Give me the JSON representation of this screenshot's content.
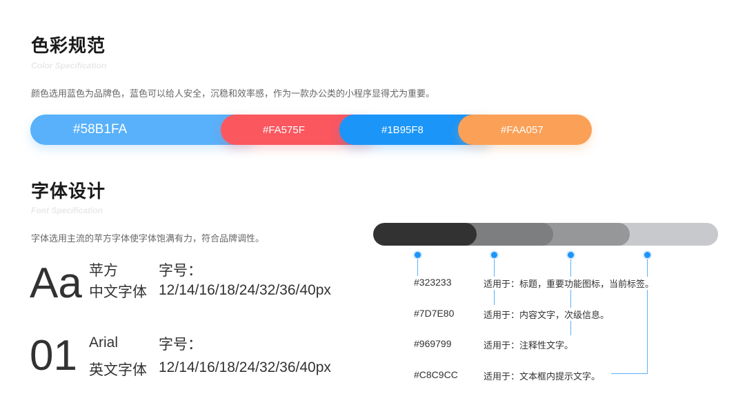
{
  "color_section": {
    "title": "色彩规范",
    "subtitle": "Color Specification",
    "description": "颜色选用蓝色为品牌色，蓝色可以给人安全，沉稳和效率感，作为一款办公类的小程序显得尤为重要。",
    "swatches": [
      {
        "label": "#58B1FA",
        "color": "#58B1FA"
      },
      {
        "label": "#FA575F",
        "color": "#FA575F"
      },
      {
        "label": "#1B95F8",
        "color": "#1B95F8"
      },
      {
        "label": "#FAA057",
        "color": "#FAA057"
      }
    ]
  },
  "font_section": {
    "title": "字体设计",
    "subtitle": "Font Specification",
    "description": "字体选用主流的苹方字体使字体饱满有力，符合品牌调性。",
    "chinese": {
      "sample": "Aa",
      "font_name": "苹方",
      "font_label": "中文字体",
      "size_label": "字号：",
      "sizes": "12/14/16/18/24/32/36/40px"
    },
    "english": {
      "sample": "01",
      "font_name": "Arial",
      "font_label": "英文字体",
      "size_label": "字号：",
      "sizes": "12/14/16/18/24/32/36/40px"
    }
  },
  "text_colors": [
    {
      "hex": "#323233",
      "usage": "适用于：标题，重要功能图标，当前标签。",
      "color": "#323233"
    },
    {
      "hex": "#7D7E80",
      "usage": "适用于：内容文字，次级信息。",
      "color": "#7D7E80"
    },
    {
      "hex": "#969799",
      "usage": "适用于：注释性文字。",
      "color": "#969799"
    },
    {
      "hex": "#C8C9CC",
      "usage": "适用于：文本框内提示文字。",
      "color": "#C8C9CC"
    }
  ],
  "accent_color": "#1B95F8"
}
